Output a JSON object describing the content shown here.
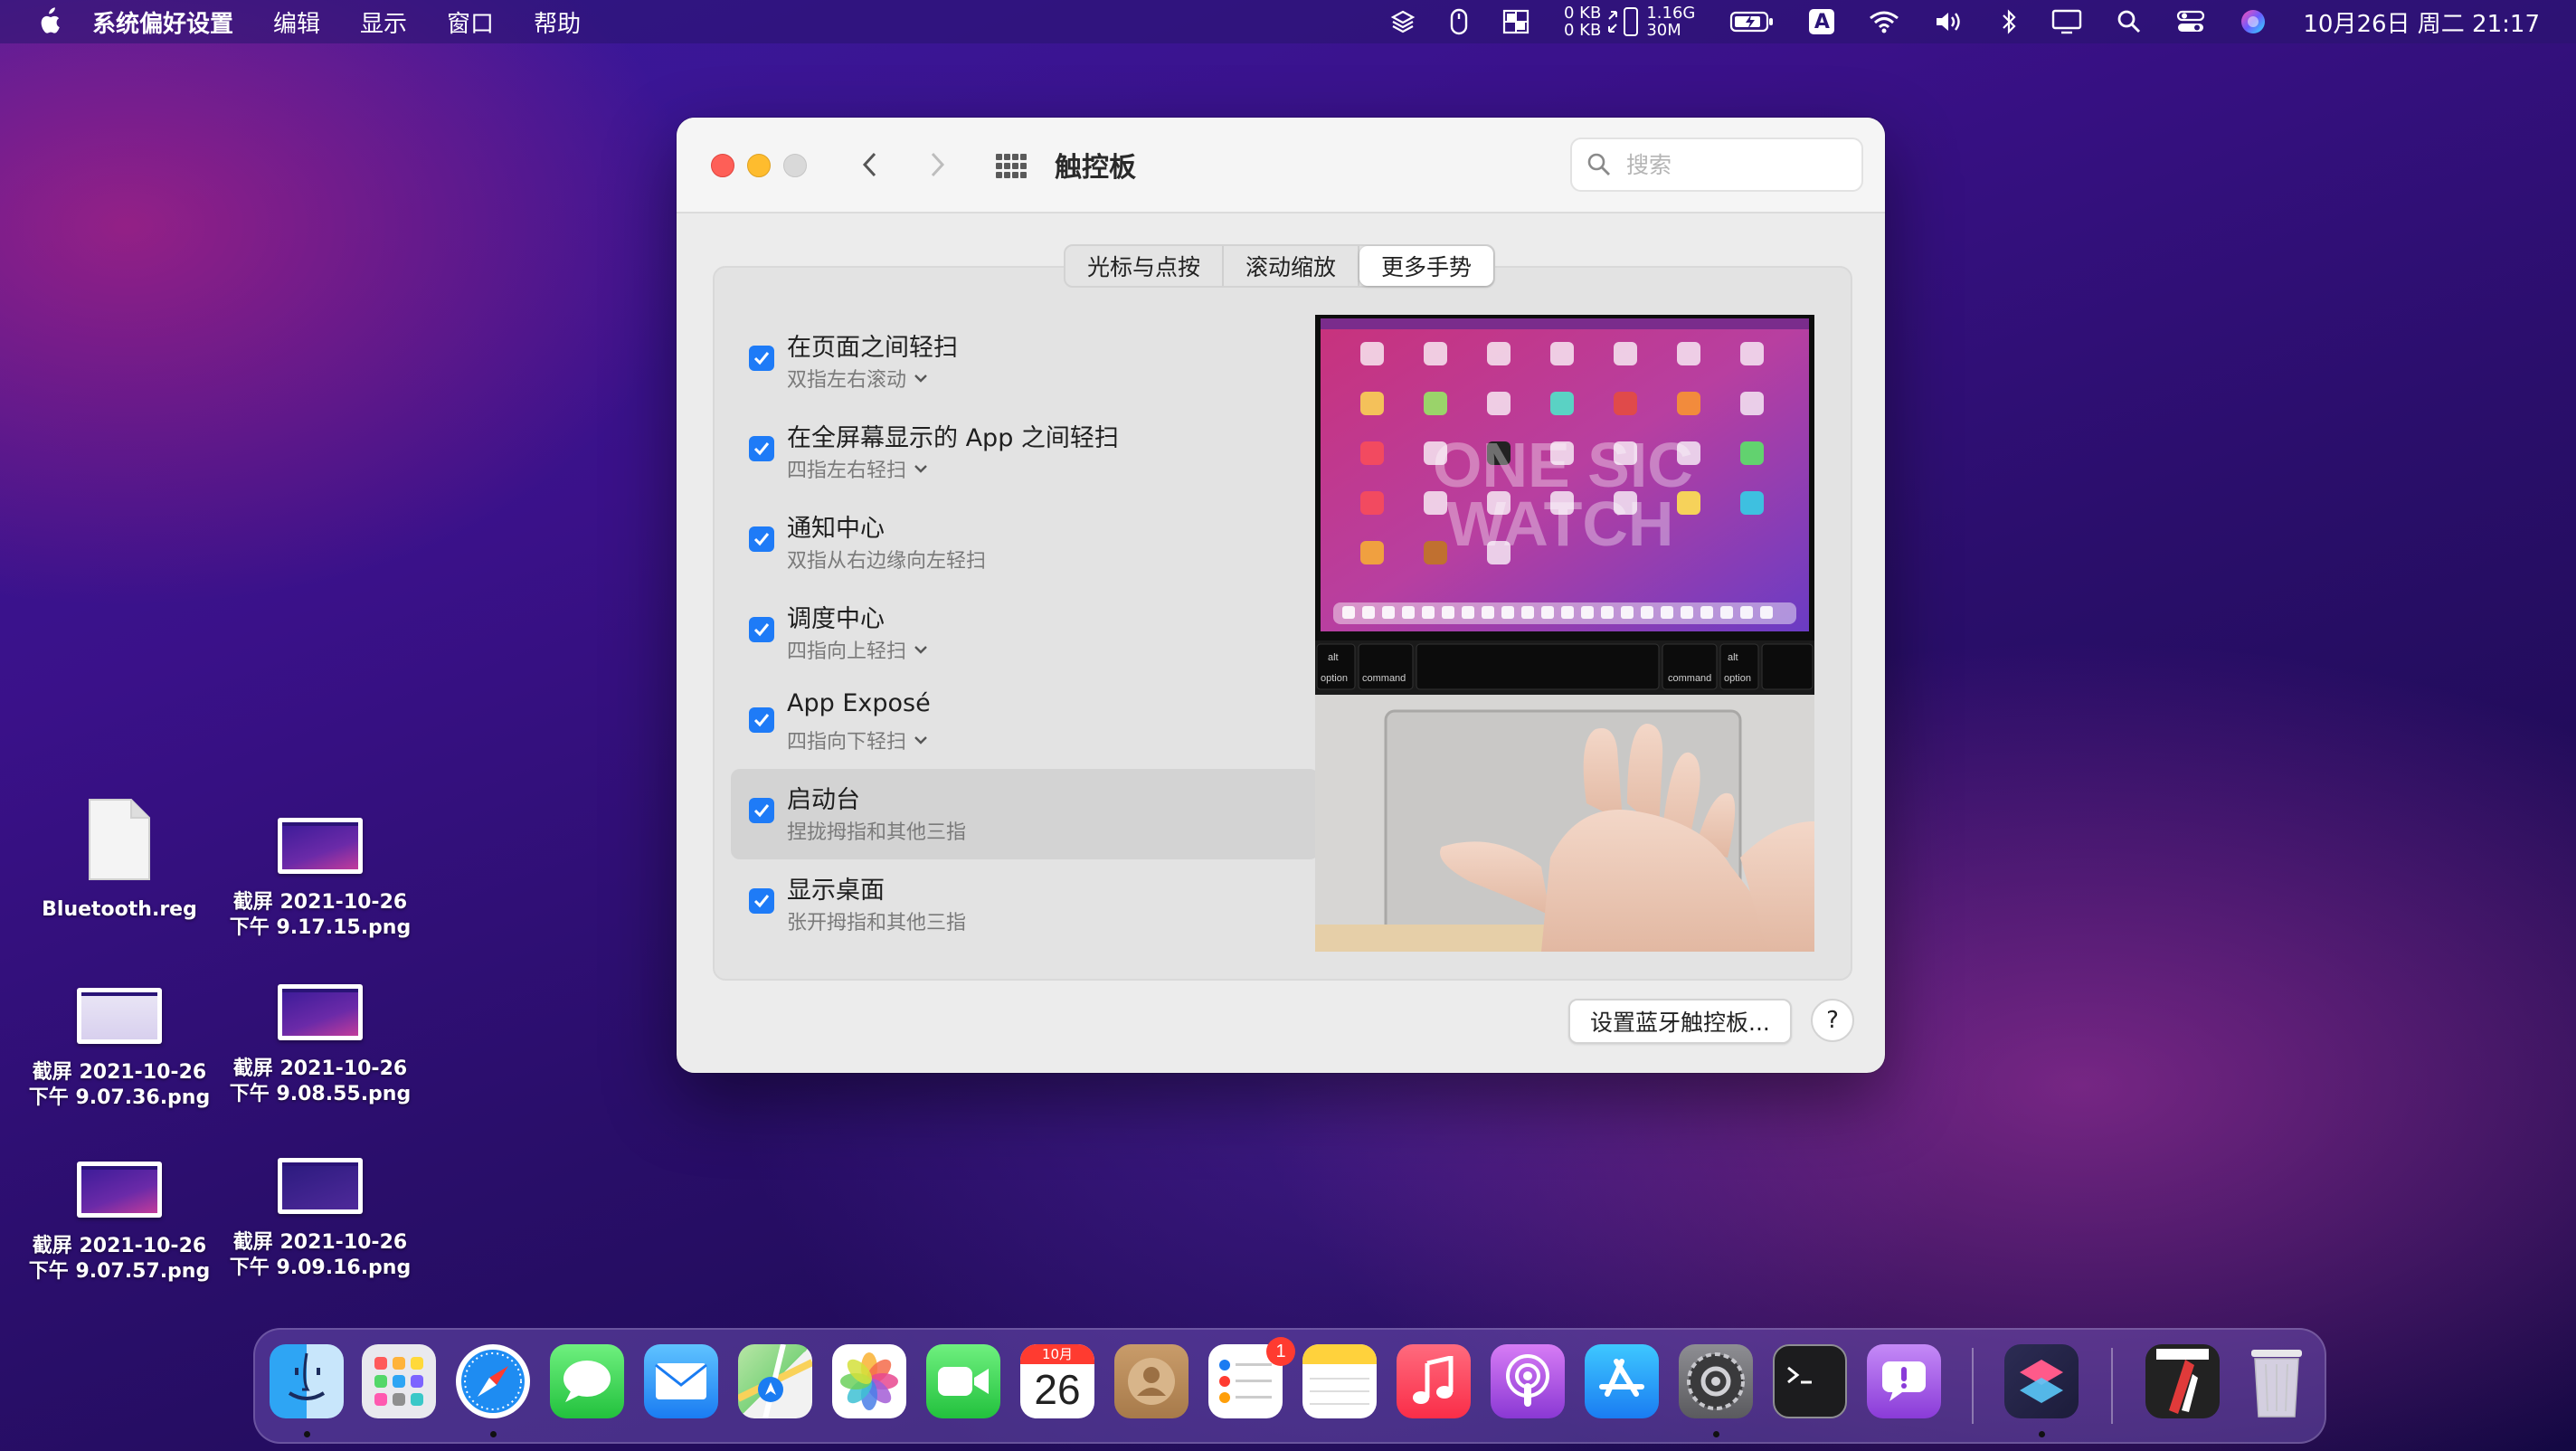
{
  "menubar": {
    "app_name": "系统偏好设置",
    "menus": [
      "编辑",
      "显示",
      "窗口",
      "帮助"
    ],
    "net_up": "0 KB",
    "net_down": "0 KB",
    "mem_total": "1.16G",
    "mem_used": "30M",
    "input_method": "A",
    "datetime": "10月26日 周二  21:17"
  },
  "window": {
    "title": "触控板",
    "search_placeholder": "搜索",
    "tabs": [
      {
        "label": "光标与点按",
        "active": false
      },
      {
        "label": "滚动缩放",
        "active": false
      },
      {
        "label": "更多手势",
        "active": true
      }
    ],
    "gestures": [
      {
        "title": "在页面之间轻扫",
        "subtitle": "双指左右滚动",
        "checked": true,
        "has_menu": true,
        "selected": false
      },
      {
        "title": "在全屏幕显示的 App 之间轻扫",
        "subtitle": "四指左右轻扫",
        "checked": true,
        "has_menu": true,
        "selected": false
      },
      {
        "title": "通知中心",
        "subtitle": "双指从右边缘向左轻扫",
        "checked": true,
        "has_menu": false,
        "selected": false
      },
      {
        "title": "调度中心",
        "subtitle": "四指向上轻扫",
        "checked": true,
        "has_menu": true,
        "selected": false
      },
      {
        "title": "App Exposé",
        "subtitle": "四指向下轻扫",
        "checked": true,
        "has_menu": true,
        "selected": false
      },
      {
        "title": "启动台",
        "subtitle": "捏拢拇指和其他三指",
        "checked": true,
        "has_menu": false,
        "selected": true
      },
      {
        "title": "显示桌面",
        "subtitle": "张开拇指和其他三指",
        "checked": true,
        "has_menu": false,
        "selected": false
      }
    ],
    "preview": {
      "keys": [
        "alt",
        "option",
        "command",
        "command",
        "alt",
        "option"
      ],
      "overlay_text": [
        "ONE SIC",
        "WATCH"
      ]
    },
    "setup_button": "设置蓝牙触控板...",
    "help_button": "?"
  },
  "desktop": {
    "items": [
      {
        "kind": "file",
        "line1": "Bluetooth.reg",
        "line2": ""
      },
      {
        "kind": "screenshot",
        "line1": "截屏 2021-10-26",
        "line2": "下午 9.17.15.png"
      },
      {
        "kind": "screenshot",
        "line1": "截屏 2021-10-26",
        "line2": "下午 9.07.36.png"
      },
      {
        "kind": "screenshot",
        "line1": "截屏 2021-10-26",
        "line2": "下午 9.08.55.png"
      },
      {
        "kind": "screenshot",
        "line1": "截屏 2021-10-26",
        "line2": "下午 9.07.57.png"
      },
      {
        "kind": "screenshot",
        "line1": "截屏 2021-10-26",
        "line2": "下午 9.09.16.png"
      }
    ]
  },
  "dock": {
    "calendar_month": "10月",
    "calendar_day": "26",
    "reminders_badge": "1",
    "apps": [
      "finder-icon",
      "launchpad-icon",
      "safari-icon",
      "messages-icon",
      "mail-icon",
      "maps-icon",
      "photos-icon",
      "facetime-icon",
      "calendar-icon",
      "contacts-icon",
      "reminders-icon",
      "notes-icon",
      "music-icon",
      "podcasts-icon",
      "app-store-icon",
      "system-preferences-icon",
      "terminal-icon",
      "feedback-assistant-icon",
      "shortcuts-icon",
      "pdf-app-icon",
      "trash-icon"
    ]
  },
  "colors": {
    "accent": "#1e7bf7",
    "close": "#fe5f57",
    "minimize": "#febc2e"
  }
}
